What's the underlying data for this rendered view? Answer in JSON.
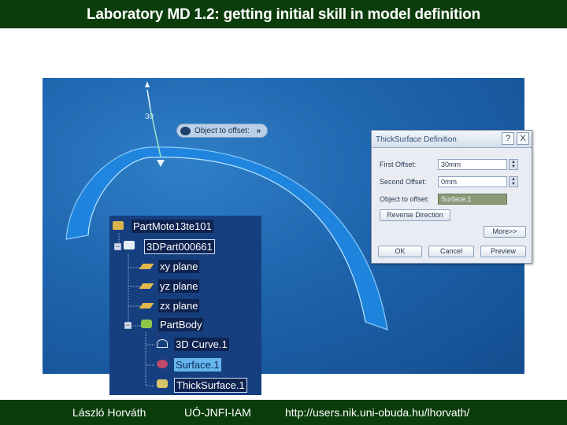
{
  "slide": {
    "title": "Laboratory MD 1.2: getting initial skill in model definition",
    "footer_author": "László Horváth",
    "footer_org": "UÓ-JNFI-IAM",
    "footer_url": "http://users.nik.uni-obuda.hu/lhorvath/"
  },
  "viewport": {
    "dimension_label": "30",
    "offset_callout": "Object to offset:",
    "callout_chevron": "»"
  },
  "dialog": {
    "title": "ThickSurface Definition",
    "help_button": "?",
    "close_button": "X",
    "first_offset_label": "First Offset:",
    "first_offset_value": "30mm",
    "second_offset_label": "Second Offset:",
    "second_offset_value": "0mm",
    "object_label": "Object to offset:",
    "object_value": "Surface.1",
    "reverse_button": "Reverse Direction",
    "more_button": "More>>",
    "ok_button": "OK",
    "cancel_button": "Cancel",
    "preview_button": "Preview"
  },
  "tree": {
    "root": "PartMote13te101",
    "part": "3DPart000661",
    "xy_plane": "xy plane",
    "yz_plane": "yz plane",
    "zx_plane": "zx plane",
    "body": "PartBody",
    "curve": "3D Curve.1",
    "surface": "Surface.1",
    "thick_surface": "ThickSurface.1"
  },
  "colors": {
    "title_bg": "#0b3d0b",
    "viewport_bg": "#1e64ad",
    "selection": "#68b6f0"
  }
}
